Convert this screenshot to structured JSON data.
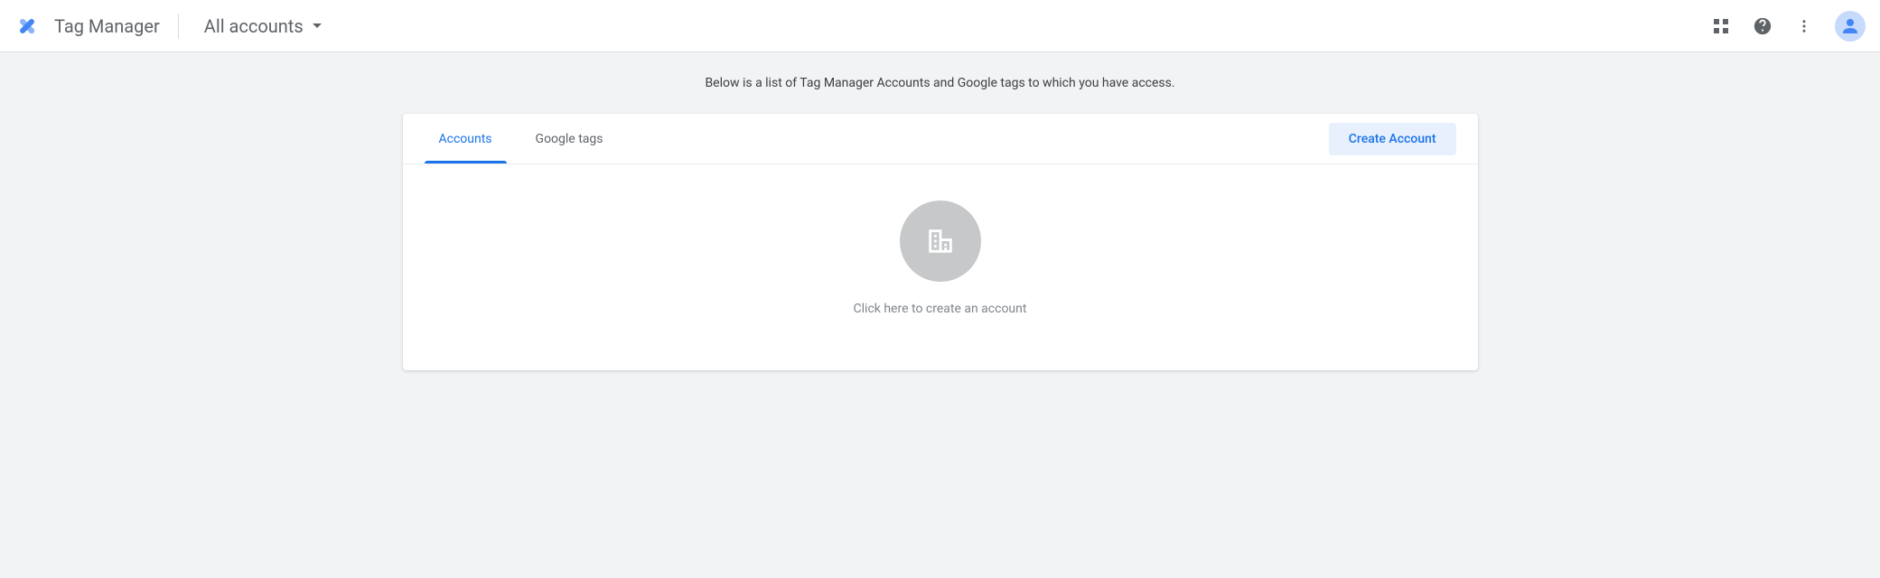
{
  "header": {
    "product_name": "Tag Manager",
    "account_selector": "All accounts"
  },
  "description": "Below is a list of Tag Manager Accounts and Google tags to which you have access.",
  "tabs": {
    "accounts": "Accounts",
    "google_tags": "Google tags"
  },
  "buttons": {
    "create_account": "Create Account"
  },
  "empty_state": {
    "text": "Click here to create an account"
  }
}
